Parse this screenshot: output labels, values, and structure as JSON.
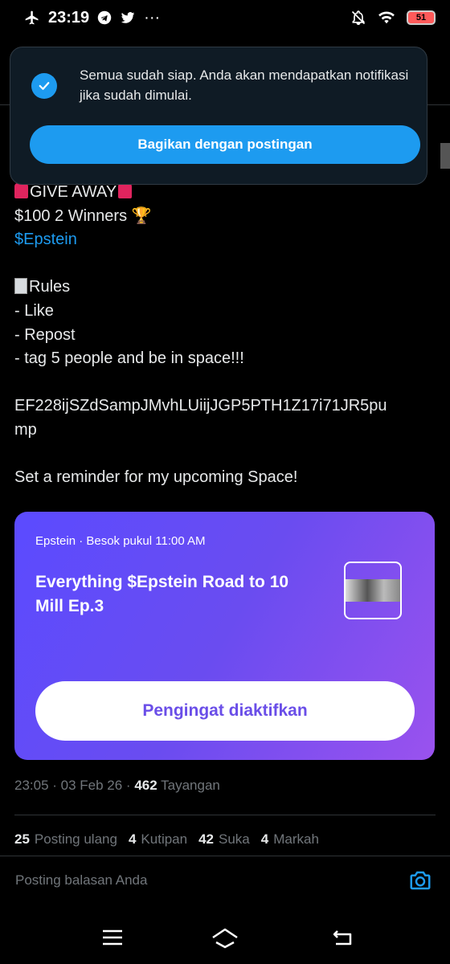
{
  "status_bar": {
    "time": "23:19",
    "more": "···",
    "battery": "51"
  },
  "toast": {
    "message": "Semua sudah siap. Anda akan mendapatkan notifikasi jika sudah dimulai.",
    "button_label": "Bagikan dengan postingan"
  },
  "post": {
    "line1": "GIVE AWAY",
    "line2": "$100 2 Winners ",
    "line2_trophy": "🏆",
    "cashtag": "$Epstein",
    "rules_title": "Rules",
    "rule1": "- Like",
    "rule2": "- Repost",
    "rule3": "- tag 5 people and be in space!!!",
    "address_line1": "EF228ijSZdSampJMvhLUiijJGP5PTH1Z17i71JR5pu",
    "address_line2": "mp",
    "reminder": "Set a reminder for my upcoming Space!"
  },
  "space_card": {
    "meta": "Epstein · Besok pukul 11:00 AM",
    "title": "Everything $Epstein Road to 10 Mill Ep.3",
    "button_label": "Pengingat diaktifkan",
    "colors": {
      "gradient_start": "#5b4bff",
      "gradient_end": "#9a52ee",
      "button_text": "#6a4ee8"
    }
  },
  "post_meta": {
    "timestamp": "23:05 · 03 Feb 26 · ",
    "views_count": "462",
    "views_label": " Tayangan"
  },
  "stats": {
    "reposts_count": "25",
    "reposts_label": "Posting ulang",
    "quotes_count": "4",
    "quotes_label": "Kutipan",
    "likes_count": "42",
    "likes_label": "Suka",
    "bookmarks_count": "4",
    "bookmarks_label": "Markah"
  },
  "reply": {
    "placeholder": "Posting balasan Anda"
  },
  "colors": {
    "accent": "#1d9bf0",
    "background": "#000000",
    "muted": "#71767b"
  }
}
